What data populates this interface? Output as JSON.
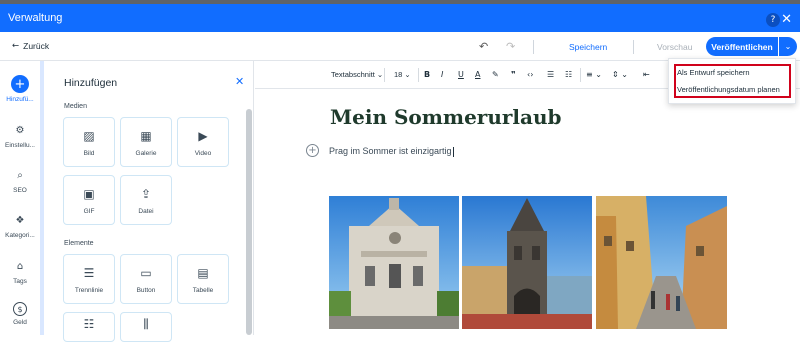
{
  "window": {
    "title": "Verwaltung",
    "help_icon": "?",
    "close_icon": "✕"
  },
  "nav": {
    "back_label": "Zurück",
    "save_label": "Speichern",
    "preview_label": "Vorschau",
    "publish_label": "Veröffentlichen"
  },
  "publish_menu": {
    "items": [
      "Als Entwurf speichern",
      "Veröffentlichungsdatum planen"
    ]
  },
  "rail": {
    "items": [
      {
        "label": "Hinzufü...",
        "icon": "plus-icon"
      },
      {
        "label": "Einstellu...",
        "icon": "gear-icon"
      },
      {
        "label": "SEO",
        "icon": "search-icon"
      },
      {
        "label": "Kategori...",
        "icon": "category-icon"
      },
      {
        "label": "Tags",
        "icon": "tag-icon"
      },
      {
        "label": "Geld",
        "icon": "money-icon"
      }
    ]
  },
  "panel": {
    "title": "Hinzufügen",
    "media_section": "Medien",
    "elements_section": "Elemente",
    "media_tiles": [
      "Bild",
      "Galerie",
      "Video",
      "GIF",
      "Datei"
    ],
    "element_tiles": [
      "Trennlinie",
      "Button",
      "Tabelle"
    ]
  },
  "toolbar": {
    "paragraph_style": "Textabschnitt",
    "font_size": "18"
  },
  "post": {
    "title": "Mein Sommerurlaub",
    "paragraph": "Prag im Sommer ist einzigartig"
  },
  "colors": {
    "accent": "#116dff",
    "highlight": "#d0021b",
    "title_green": "#1f3a2c"
  }
}
